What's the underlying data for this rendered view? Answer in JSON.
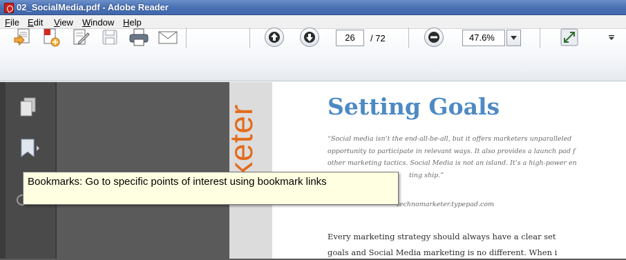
{
  "window": {
    "title": "02_SocialMedia.pdf - Adobe Reader"
  },
  "menu": {
    "items": [
      {
        "label": "File",
        "hotkey": "F",
        "rest": "ile"
      },
      {
        "label": "Edit",
        "hotkey": "E",
        "rest": "dit"
      },
      {
        "label": "View",
        "hotkey": "V",
        "rest": "iew"
      },
      {
        "label": "Window",
        "hotkey": "W",
        "rest": "indow"
      },
      {
        "label": "Help",
        "hotkey": "H",
        "rest": "elp"
      }
    ]
  },
  "toolbar": {
    "icons": [
      "open-icon",
      "create-pdf-icon",
      "edit-icon",
      "save-icon",
      "print-icon",
      "email-icon",
      "previous-page-icon",
      "next-page-icon",
      "zoom-out-icon",
      "fit-window-icon"
    ],
    "page_current": "26",
    "page_total": "/ 72",
    "zoom_value": "47.6%"
  },
  "sidebar": {
    "icons": [
      "pages-icon",
      "bookmarks-icon"
    ]
  },
  "tooltip": {
    "text": "Bookmarks: Go to specific points of interest using bookmark links"
  },
  "document": {
    "side_text": "keter",
    "title": "Setting Goals",
    "quote_lines": [
      "“Social media isn’t the end-all-be-all, but it offers marketers unparalleled",
      "opportunity to participate in relevant ways. It also provides a launch pad f",
      "other marketing tactics. Social Media is not an island. It’s a high-power en",
      "ting ship.”"
    ],
    "attribution": "technomarketer.typepad.com",
    "body_lines": [
      "Every marketing strategy should always have a clear set",
      "goals and Social Media marketing is no different. When i"
    ]
  },
  "colors": {
    "title_blue": "#4d8ac4",
    "side_orange": "#e36b1c",
    "tooltip_bg": "#ffffe1",
    "pdf_red": "#c8211c"
  }
}
